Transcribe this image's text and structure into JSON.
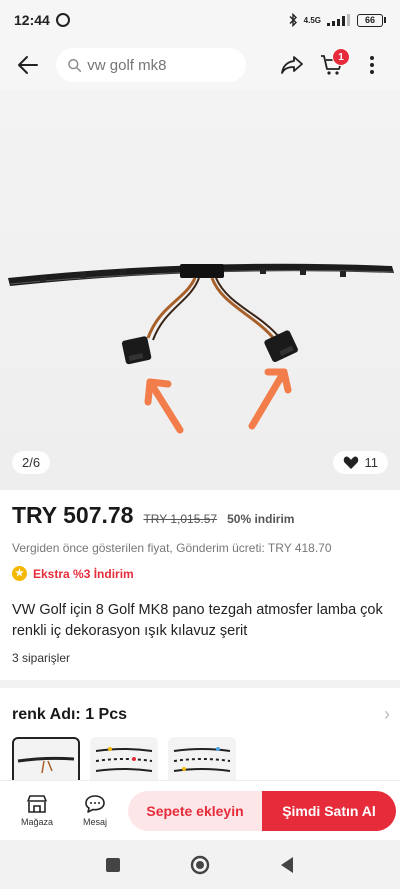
{
  "status_bar": {
    "time": "12:44",
    "network": "4.5G",
    "battery": "66"
  },
  "search": {
    "placeholder": "vw golf mk8"
  },
  "cart": {
    "badge_count": "1"
  },
  "gallery": {
    "counter": "2/6",
    "wishlist_count": "11"
  },
  "product": {
    "price": "TRY 507.78",
    "old_price": "TRY 1,015.57",
    "discount": "50% indirim",
    "subinfo": "Vergiden önce gösterilen fiyat, Gönderim ücreti: TRY 418.70",
    "extra_discount": "Ekstra %3 İndirim",
    "title": "VW Golf için 8 Golf MK8 pano tezgah atmosfer lamba çok renkli iç dekorasyon ışık kılavuz şerit",
    "orders": "3 siparişler"
  },
  "variant": {
    "label": "renk Adı: 1 Pcs"
  },
  "bottom_bar": {
    "store_label": "Mağaza",
    "message_label": "Mesaj",
    "add_to_cart": "Sepete ekleyin",
    "buy_now": "Şimdi Satın Al"
  },
  "colors": {
    "accent": "#e62c3b",
    "accent_light": "#fde6e7",
    "badge_yellow": "#f5b800"
  }
}
